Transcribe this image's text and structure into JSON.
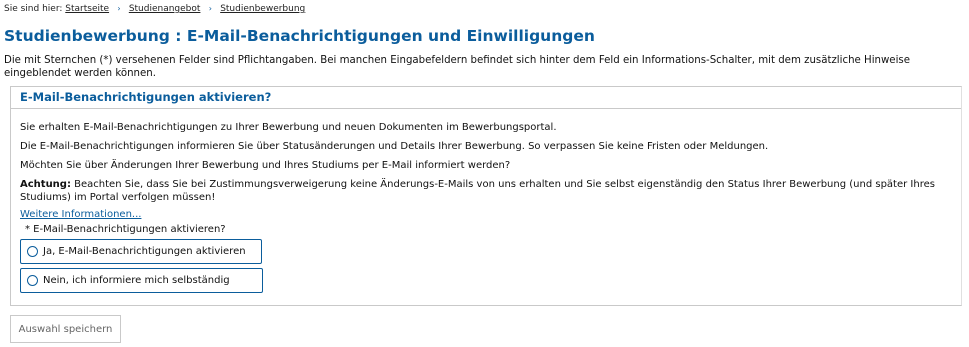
{
  "breadcrumb": {
    "prefix": "Sie sind hier:",
    "items": [
      "Startseite",
      "Studienangebot",
      "Studienbewerbung"
    ],
    "separator": "›"
  },
  "page": {
    "title": "Studienbewerbung : E-Mail-Benachrichtigungen und Einwilligungen",
    "intro": "Die mit Sternchen (*) versehenen Felder sind Pflichtangaben. Bei manchen Eingabefeldern befindet sich hinter dem Feld ein Informations-Schalter, mit dem zusätzliche Hinweise eingeblendet werden können."
  },
  "panel": {
    "title": "E-Mail-Benachrichtigungen aktivieren?",
    "paragraphs": [
      "Sie erhalten E-Mail-Benachrichtigungen zu Ihrer Bewerbung und neuen Dokumenten im Bewerbungsportal.",
      "Die E-Mail-Benachrichtigungen informieren Sie über Statusänderungen und Details Ihrer Bewerbung. So verpassen Sie keine Fristen oder Meldungen.",
      "Möchten Sie über Änderungen Ihrer Bewerbung und Ihres Studiums per E-Mail informiert werden?"
    ],
    "warning_label": "Achtung:",
    "warning_text": " Beachten Sie, dass Sie bei Zustimmungsverweigerung keine Änderungs-E-Mails von uns erhalten und Sie selbst eigenständig den Status Ihrer Bewerbung (und später Ihres Studiums) im Portal verfolgen müssen!",
    "more_link": "Weitere Informationen...",
    "question": "* E-Mail-Benachrichtigungen aktivieren?",
    "options": [
      "Ja, E-Mail-Benachrichtigungen aktivieren",
      "Nein, ich informiere mich selbständig"
    ]
  },
  "actions": {
    "save_label": "Auswahl speichern"
  },
  "colors": {
    "accent": "#0b5d9c",
    "border": "#c9c9c9",
    "button_text": "#666666"
  }
}
